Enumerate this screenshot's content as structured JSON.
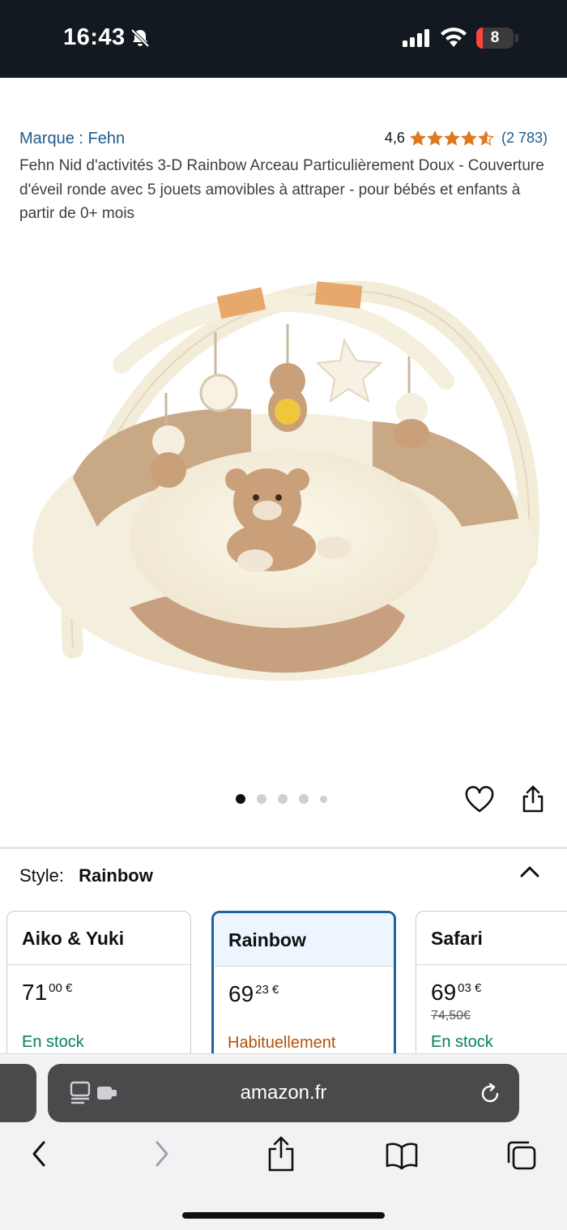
{
  "status_bar": {
    "time": "16:43",
    "battery_level": "8",
    "icons": [
      "bell-slash-icon",
      "cellular-signal-icon",
      "wifi-icon",
      "battery-icon"
    ]
  },
  "product": {
    "brand": "Marque : Fehn",
    "rating": "4,6",
    "rating_stars": 4.6,
    "review_count": "(2 783)",
    "title": "Fehn Nid d'activités 3-D Rainbow Arceau Particulièrement Doux - Couverture d'éveil ronde avec 5 jouets amovibles à attraper - pour bébés et enfants à partir de 0+ mois"
  },
  "carousel": {
    "count": 5,
    "active_index": 0
  },
  "style_selector": {
    "label": "Style:",
    "selected": "Rainbow",
    "options": [
      {
        "name": "Aiko & Yuki",
        "price_whole": "71",
        "price_fraction": "00 €",
        "old_price": "",
        "availability": "En stock",
        "availability_type": "in-stock"
      },
      {
        "name": "Rainbow",
        "price_whole": "69",
        "price_fraction": "23 €",
        "old_price": "",
        "availability": "Habituellement",
        "availability_type": "usually"
      },
      {
        "name": "Safari",
        "price_whole": "69",
        "price_fraction": "03 €",
        "old_price": "74,50€",
        "availability": "En stock",
        "availability_type": "in-stock"
      }
    ]
  },
  "browser": {
    "url": "amazon.fr",
    "toolbar": [
      "back-icon",
      "forward-icon",
      "share-icon",
      "bookmarks-icon",
      "tabs-icon"
    ]
  },
  "colors": {
    "header_bg": "#131921",
    "link": "#1f5a8b",
    "star": "#de7921",
    "selected_border": "#2162a1",
    "in_stock": "#067d62",
    "usually": "#b4510a"
  }
}
